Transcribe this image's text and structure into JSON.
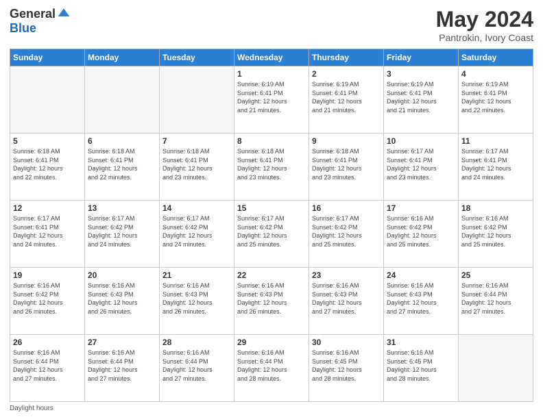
{
  "logo": {
    "general": "General",
    "blue": "Blue"
  },
  "title": {
    "month_year": "May 2024",
    "location": "Pantrokin, Ivory Coast"
  },
  "days_of_week": [
    "Sunday",
    "Monday",
    "Tuesday",
    "Wednesday",
    "Thursday",
    "Friday",
    "Saturday"
  ],
  "weeks": [
    [
      {
        "day": "",
        "info": ""
      },
      {
        "day": "",
        "info": ""
      },
      {
        "day": "",
        "info": ""
      },
      {
        "day": "1",
        "info": "Sunrise: 6:19 AM\nSunset: 6:41 PM\nDaylight: 12 hours\nand 21 minutes."
      },
      {
        "day": "2",
        "info": "Sunrise: 6:19 AM\nSunset: 6:41 PM\nDaylight: 12 hours\nand 21 minutes."
      },
      {
        "day": "3",
        "info": "Sunrise: 6:19 AM\nSunset: 6:41 PM\nDaylight: 12 hours\nand 21 minutes."
      },
      {
        "day": "4",
        "info": "Sunrise: 6:19 AM\nSunset: 6:41 PM\nDaylight: 12 hours\nand 22 minutes."
      }
    ],
    [
      {
        "day": "5",
        "info": "Sunrise: 6:18 AM\nSunset: 6:41 PM\nDaylight: 12 hours\nand 22 minutes."
      },
      {
        "day": "6",
        "info": "Sunrise: 6:18 AM\nSunset: 6:41 PM\nDaylight: 12 hours\nand 22 minutes."
      },
      {
        "day": "7",
        "info": "Sunrise: 6:18 AM\nSunset: 6:41 PM\nDaylight: 12 hours\nand 23 minutes."
      },
      {
        "day": "8",
        "info": "Sunrise: 6:18 AM\nSunset: 6:41 PM\nDaylight: 12 hours\nand 23 minutes."
      },
      {
        "day": "9",
        "info": "Sunrise: 6:18 AM\nSunset: 6:41 PM\nDaylight: 12 hours\nand 23 minutes."
      },
      {
        "day": "10",
        "info": "Sunrise: 6:17 AM\nSunset: 6:41 PM\nDaylight: 12 hours\nand 23 minutes."
      },
      {
        "day": "11",
        "info": "Sunrise: 6:17 AM\nSunset: 6:41 PM\nDaylight: 12 hours\nand 24 minutes."
      }
    ],
    [
      {
        "day": "12",
        "info": "Sunrise: 6:17 AM\nSunset: 6:41 PM\nDaylight: 12 hours\nand 24 minutes."
      },
      {
        "day": "13",
        "info": "Sunrise: 6:17 AM\nSunset: 6:42 PM\nDaylight: 12 hours\nand 24 minutes."
      },
      {
        "day": "14",
        "info": "Sunrise: 6:17 AM\nSunset: 6:42 PM\nDaylight: 12 hours\nand 24 minutes."
      },
      {
        "day": "15",
        "info": "Sunrise: 6:17 AM\nSunset: 6:42 PM\nDaylight: 12 hours\nand 25 minutes."
      },
      {
        "day": "16",
        "info": "Sunrise: 6:17 AM\nSunset: 6:42 PM\nDaylight: 12 hours\nand 25 minutes."
      },
      {
        "day": "17",
        "info": "Sunrise: 6:16 AM\nSunset: 6:42 PM\nDaylight: 12 hours\nand 25 minutes."
      },
      {
        "day": "18",
        "info": "Sunrise: 6:16 AM\nSunset: 6:42 PM\nDaylight: 12 hours\nand 25 minutes."
      }
    ],
    [
      {
        "day": "19",
        "info": "Sunrise: 6:16 AM\nSunset: 6:42 PM\nDaylight: 12 hours\nand 26 minutes."
      },
      {
        "day": "20",
        "info": "Sunrise: 6:16 AM\nSunset: 6:43 PM\nDaylight: 12 hours\nand 26 minutes."
      },
      {
        "day": "21",
        "info": "Sunrise: 6:16 AM\nSunset: 6:43 PM\nDaylight: 12 hours\nand 26 minutes."
      },
      {
        "day": "22",
        "info": "Sunrise: 6:16 AM\nSunset: 6:43 PM\nDaylight: 12 hours\nand 26 minutes."
      },
      {
        "day": "23",
        "info": "Sunrise: 6:16 AM\nSunset: 6:43 PM\nDaylight: 12 hours\nand 27 minutes."
      },
      {
        "day": "24",
        "info": "Sunrise: 6:16 AM\nSunset: 6:43 PM\nDaylight: 12 hours\nand 27 minutes."
      },
      {
        "day": "25",
        "info": "Sunrise: 6:16 AM\nSunset: 6:44 PM\nDaylight: 12 hours\nand 27 minutes."
      }
    ],
    [
      {
        "day": "26",
        "info": "Sunrise: 6:16 AM\nSunset: 6:44 PM\nDaylight: 12 hours\nand 27 minutes."
      },
      {
        "day": "27",
        "info": "Sunrise: 6:16 AM\nSunset: 6:44 PM\nDaylight: 12 hours\nand 27 minutes."
      },
      {
        "day": "28",
        "info": "Sunrise: 6:16 AM\nSunset: 6:44 PM\nDaylight: 12 hours\nand 27 minutes."
      },
      {
        "day": "29",
        "info": "Sunrise: 6:16 AM\nSunset: 6:44 PM\nDaylight: 12 hours\nand 28 minutes."
      },
      {
        "day": "30",
        "info": "Sunrise: 6:16 AM\nSunset: 6:45 PM\nDaylight: 12 hours\nand 28 minutes."
      },
      {
        "day": "31",
        "info": "Sunrise: 6:16 AM\nSunset: 6:45 PM\nDaylight: 12 hours\nand 28 minutes."
      },
      {
        "day": "",
        "info": ""
      }
    ]
  ],
  "footer": {
    "note": "Daylight hours"
  },
  "colors": {
    "header_bg": "#2b7fd4",
    "header_text": "#ffffff",
    "accent_blue": "#1a6abf"
  }
}
